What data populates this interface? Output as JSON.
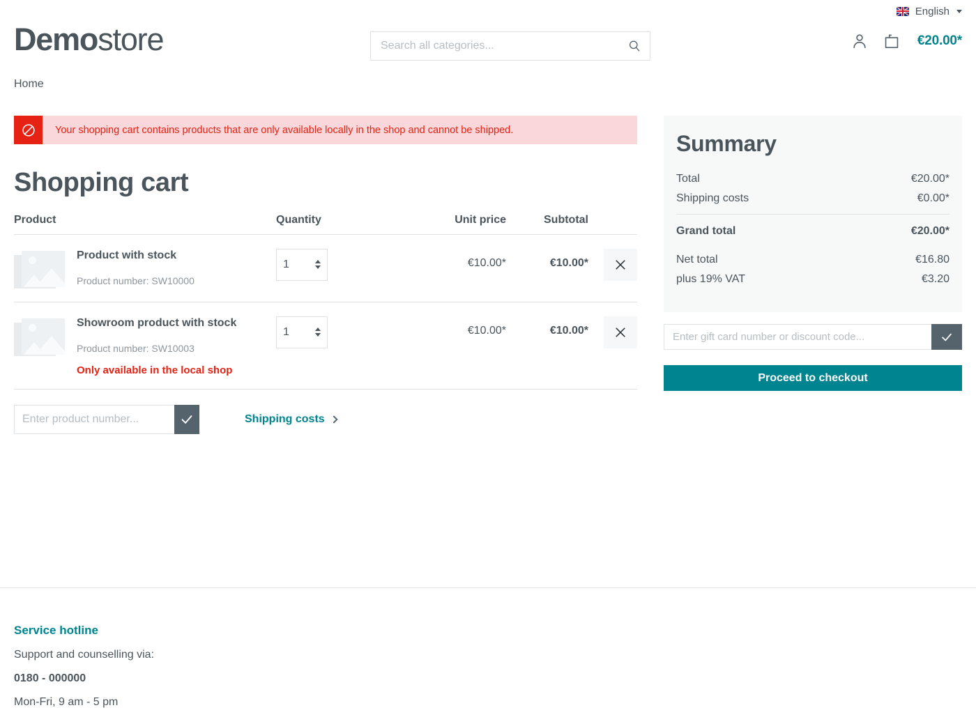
{
  "topbar": {
    "language": "English",
    "flag_icon": "uk-flag-icon",
    "caret_icon": "chevron-down-icon"
  },
  "header": {
    "logo_bold": "Demo",
    "logo_light": "store",
    "search_placeholder": "Search all categories...",
    "search_value": "",
    "search_icon": "search-icon",
    "account_icon": "person-icon",
    "cart_icon": "shopping-bag-icon",
    "cart_amount": "€20.00*"
  },
  "breadcrumb": {
    "home": "Home"
  },
  "alert": {
    "icon": "prohibited-icon",
    "message": "Your shopping cart contains products that are only available locally in the shop and cannot be shipped.",
    "bg_color": "#fad7da",
    "accent_color": "#e52213"
  },
  "page": {
    "title": "Shopping cart"
  },
  "cart": {
    "columns": {
      "product": "Product",
      "quantity": "Quantity",
      "unit_price": "Unit price",
      "subtotal": "Subtotal"
    },
    "items": [
      {
        "name": "Product with stock",
        "product_number_label": "Product number: SW10000",
        "quantity": "1",
        "unit_price": "€10.00*",
        "subtotal": "€10.00*",
        "notice": "",
        "remove_icon": "close-icon",
        "thumb_icon": "image-placeholder-icon"
      },
      {
        "name": "Showroom product with stock",
        "product_number_label": "Product number: SW10003",
        "quantity": "1",
        "unit_price": "€10.00*",
        "subtotal": "€10.00*",
        "notice": "Only available in the local shop",
        "remove_icon": "close-icon",
        "thumb_icon": "image-placeholder-icon"
      }
    ],
    "product_number_placeholder": "Enter product number...",
    "product_number_value": "",
    "submit_icon": "check-icon",
    "shipping_costs_link": "Shipping costs",
    "shipping_costs_chevron": "chevron-right-icon"
  },
  "summary": {
    "title": "Summary",
    "rows": [
      {
        "label": "Total",
        "value": "€20.00*"
      },
      {
        "label": "Shipping costs",
        "value": "€0.00*"
      }
    ],
    "grand_total": {
      "label": "Grand total",
      "value": "€20.00*"
    },
    "tax_rows": [
      {
        "label": "Net total",
        "value": "€16.80"
      },
      {
        "label": "plus 19% VAT",
        "value": "€3.20"
      }
    ],
    "giftcard_placeholder": "Enter gift card number or discount code...",
    "giftcard_value": "",
    "giftcard_submit_icon": "check-icon",
    "checkout_label": "Proceed to checkout",
    "accent_color": "#008490"
  },
  "footer": {
    "hotline_title": "Service hotline",
    "support_text": "Support and counselling via:",
    "phone": "0180 - 000000",
    "hours": "Mon-Fri, 9 am - 5 pm"
  }
}
